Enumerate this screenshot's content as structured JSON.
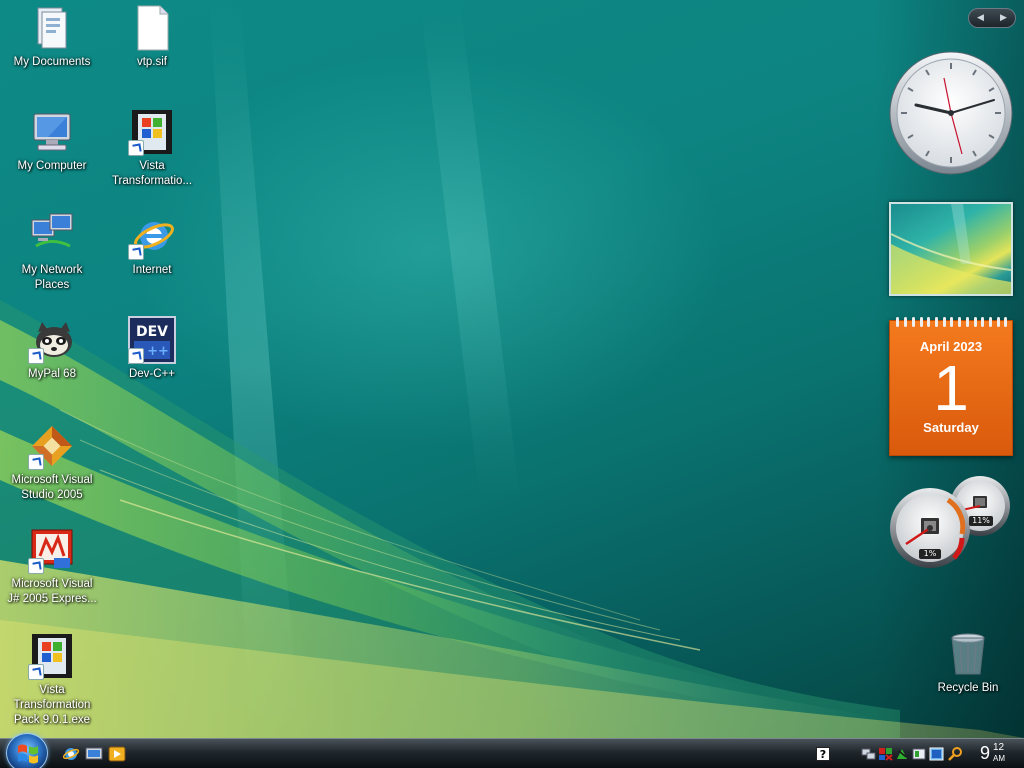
{
  "desktop": {
    "icons": [
      {
        "label": "My Documents",
        "icon": "my-documents-icon"
      },
      {
        "label": "vtp.sif",
        "icon": "file-icon"
      },
      {
        "label": "My Computer",
        "icon": "computer-icon"
      },
      {
        "label": "Vista\nTransformatio...",
        "icon": "vista-transformation-icon"
      },
      {
        "label": "My Network\nPlaces",
        "icon": "network-icon"
      },
      {
        "label": "Internet",
        "icon": "internet-explorer-icon"
      },
      {
        "label": "MyPal 68",
        "icon": "mypal-icon"
      },
      {
        "label": "Dev-C++",
        "icon": "dev-cpp-icon"
      },
      {
        "label": "Microsoft Visual\nStudio 2005",
        "icon": "visual-studio-icon"
      },
      {
        "label": "Microsoft Visual\nJ# 2005 Expres...",
        "icon": "visual-jsharp-icon"
      },
      {
        "label": "Vista\nTransformation\nPack 9.0.1.exe",
        "icon": "vista-installer-icon"
      }
    ],
    "recycle_bin": {
      "label": "Recycle Bin"
    }
  },
  "sidebar": {
    "calendar": {
      "month_year": "April 2023",
      "day": "1",
      "weekday": "Saturday"
    },
    "meters": {
      "cpu": "1%",
      "memory": "11%"
    }
  },
  "taskbar": {
    "tray_help": "?",
    "clock": {
      "hour": "9",
      "minute": "12",
      "ampm": "AM"
    }
  },
  "colors": {
    "calendar": "#e8680f",
    "taskbar": "#1c2328",
    "wallpaper": "#0d8481"
  }
}
